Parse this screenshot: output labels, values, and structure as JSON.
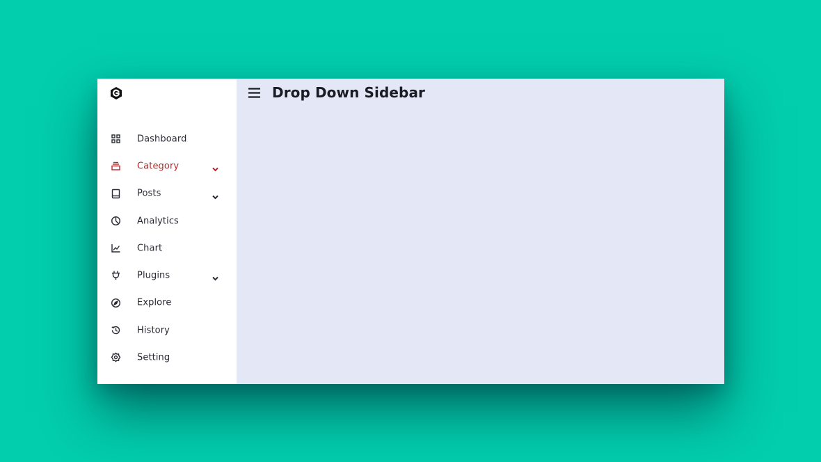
{
  "header": {
    "title": "Drop Down Sidebar"
  },
  "sidebar": {
    "items": [
      {
        "label": "Dashboard",
        "icon": "grid-icon",
        "has_dropdown": false,
        "active": false
      },
      {
        "label": "Category",
        "icon": "collection-icon",
        "has_dropdown": true,
        "active": true
      },
      {
        "label": "Posts",
        "icon": "book-icon",
        "has_dropdown": true,
        "active": false
      },
      {
        "label": "Analytics",
        "icon": "pie-chart-icon",
        "has_dropdown": false,
        "active": false
      },
      {
        "label": "Chart",
        "icon": "line-chart-icon",
        "has_dropdown": false,
        "active": false
      },
      {
        "label": "Plugins",
        "icon": "plug-icon",
        "has_dropdown": true,
        "active": false
      },
      {
        "label": "Explore",
        "icon": "compass-icon",
        "has_dropdown": false,
        "active": false
      },
      {
        "label": "History",
        "icon": "history-icon",
        "has_dropdown": false,
        "active": false
      },
      {
        "label": "Setting",
        "icon": "gear-icon",
        "has_dropdown": false,
        "active": false
      }
    ]
  },
  "colors": {
    "background": "#02cdad",
    "sidebar": "#ffffff",
    "content": "#e4e8f6",
    "active": "#b22a2a",
    "text": "#2a2a35"
  }
}
